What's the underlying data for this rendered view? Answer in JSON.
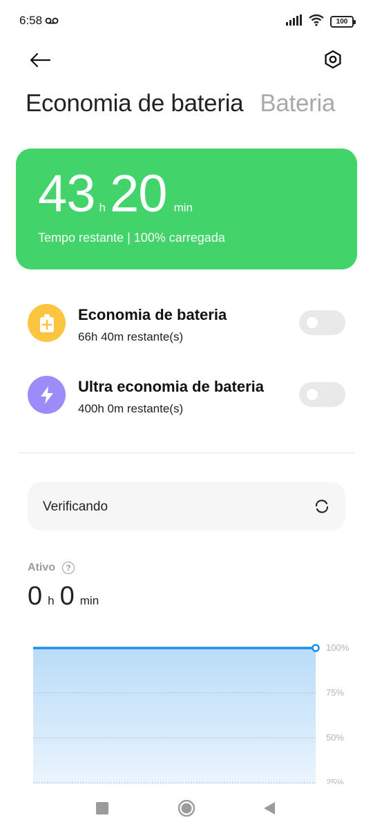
{
  "status_bar": {
    "time": "6:58",
    "voicemail_icon": "voicemail-icon",
    "battery_level": "100"
  },
  "header": {
    "back_icon": "arrow-left-icon",
    "settings_icon": "hexagon-gear-icon"
  },
  "tabs": [
    {
      "label": "Economia de bateria",
      "active": true
    },
    {
      "label": "Bateria",
      "active": false
    }
  ],
  "battery_card": {
    "hours": "43",
    "hours_unit": "h",
    "minutes": "20",
    "minutes_unit": "min",
    "subtitle": "Tempo restante | 100% carregada",
    "color": "#42d36b"
  },
  "modes": [
    {
      "title": "Economia de bateria",
      "subtitle": "66h 40m restante(s)",
      "icon": "battery-plus-icon",
      "icon_color": "#fcc53f",
      "enabled": false
    },
    {
      "title": "Ultra economia de bateria",
      "subtitle": "400h 0m restante(s)",
      "icon": "lightning-icon",
      "icon_color": "#9b8cf9",
      "enabled": false
    }
  ],
  "check": {
    "label": "Verificando",
    "icon": "refresh-icon"
  },
  "active": {
    "label": "Ativo",
    "hours": "0",
    "hours_unit": "h",
    "minutes": "0",
    "minutes_unit": "min"
  },
  "chart_data": {
    "type": "area",
    "y_tick_labels": [
      "100%",
      "75%",
      "50%",
      "25%"
    ],
    "ylim": [
      0,
      100
    ],
    "series": [
      {
        "values": [
          100,
          100
        ]
      }
    ],
    "line_color": "#1e8ee8",
    "fill_color": "#cfe8fb"
  },
  "nav": {
    "recent_icon": "square-icon",
    "home_icon": "circle-icon",
    "back_icon": "triangle-back-icon"
  }
}
